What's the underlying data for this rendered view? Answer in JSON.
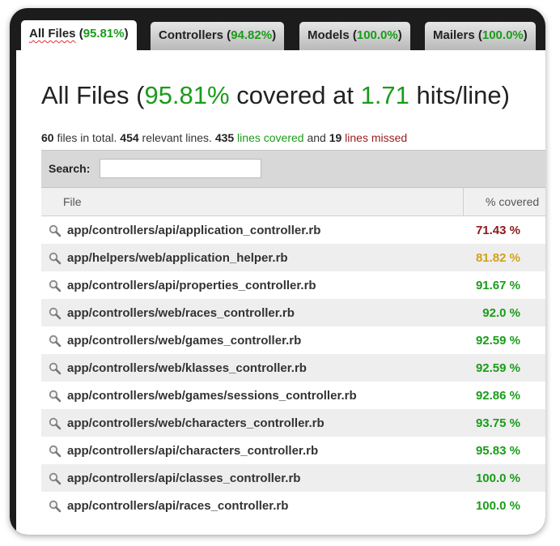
{
  "tabs": [
    {
      "label": "All Files",
      "pct": "95.81%"
    },
    {
      "label": "Controllers",
      "pct": "94.82%"
    },
    {
      "label": "Models",
      "pct": "100.0%"
    },
    {
      "label": "Mailers",
      "pct": "100.0%"
    }
  ],
  "header": {
    "title_prefix": "All Files (",
    "covered_pct": "95.81%",
    "title_mid": " covered at ",
    "hits": "1.71",
    "title_suffix": " hits/line)"
  },
  "stats": {
    "files": "60",
    "files_text": " files in total. ",
    "relevant": "454",
    "relevant_text": " relevant lines. ",
    "covered": "435",
    "covered_text": " lines covered",
    "and_text": " and ",
    "missed": "19",
    "missed_text": " lines missed"
  },
  "search": {
    "label": "Search:",
    "value": ""
  },
  "table": {
    "col_file": "File",
    "col_covered": "% covered",
    "rows": [
      {
        "file": "app/controllers/api/application_controller.rb",
        "covered": "71.43 %",
        "level": "low"
      },
      {
        "file": "app/helpers/web/application_helper.rb",
        "covered": "81.82 %",
        "level": "mid"
      },
      {
        "file": "app/controllers/api/properties_controller.rb",
        "covered": "91.67 %",
        "level": "high"
      },
      {
        "file": "app/controllers/web/races_controller.rb",
        "covered": "92.0 %",
        "level": "high"
      },
      {
        "file": "app/controllers/web/games_controller.rb",
        "covered": "92.59 %",
        "level": "high"
      },
      {
        "file": "app/controllers/web/klasses_controller.rb",
        "covered": "92.59 %",
        "level": "high"
      },
      {
        "file": "app/controllers/web/games/sessions_controller.rb",
        "covered": "92.86 %",
        "level": "high"
      },
      {
        "file": "app/controllers/web/characters_controller.rb",
        "covered": "93.75 %",
        "level": "high"
      },
      {
        "file": "app/controllers/api/characters_controller.rb",
        "covered": "95.83 %",
        "level": "high"
      },
      {
        "file": "app/controllers/api/classes_controller.rb",
        "covered": "100.0 %",
        "level": "high"
      },
      {
        "file": "app/controllers/api/races_controller.rb",
        "covered": "100.0 %",
        "level": "high"
      }
    ]
  },
  "colors": {
    "green": "#1a9c1a",
    "red": "#9b1c1c",
    "yellow": "#d4a017"
  },
  "icons": {
    "row_icon": "magnifier-icon"
  }
}
